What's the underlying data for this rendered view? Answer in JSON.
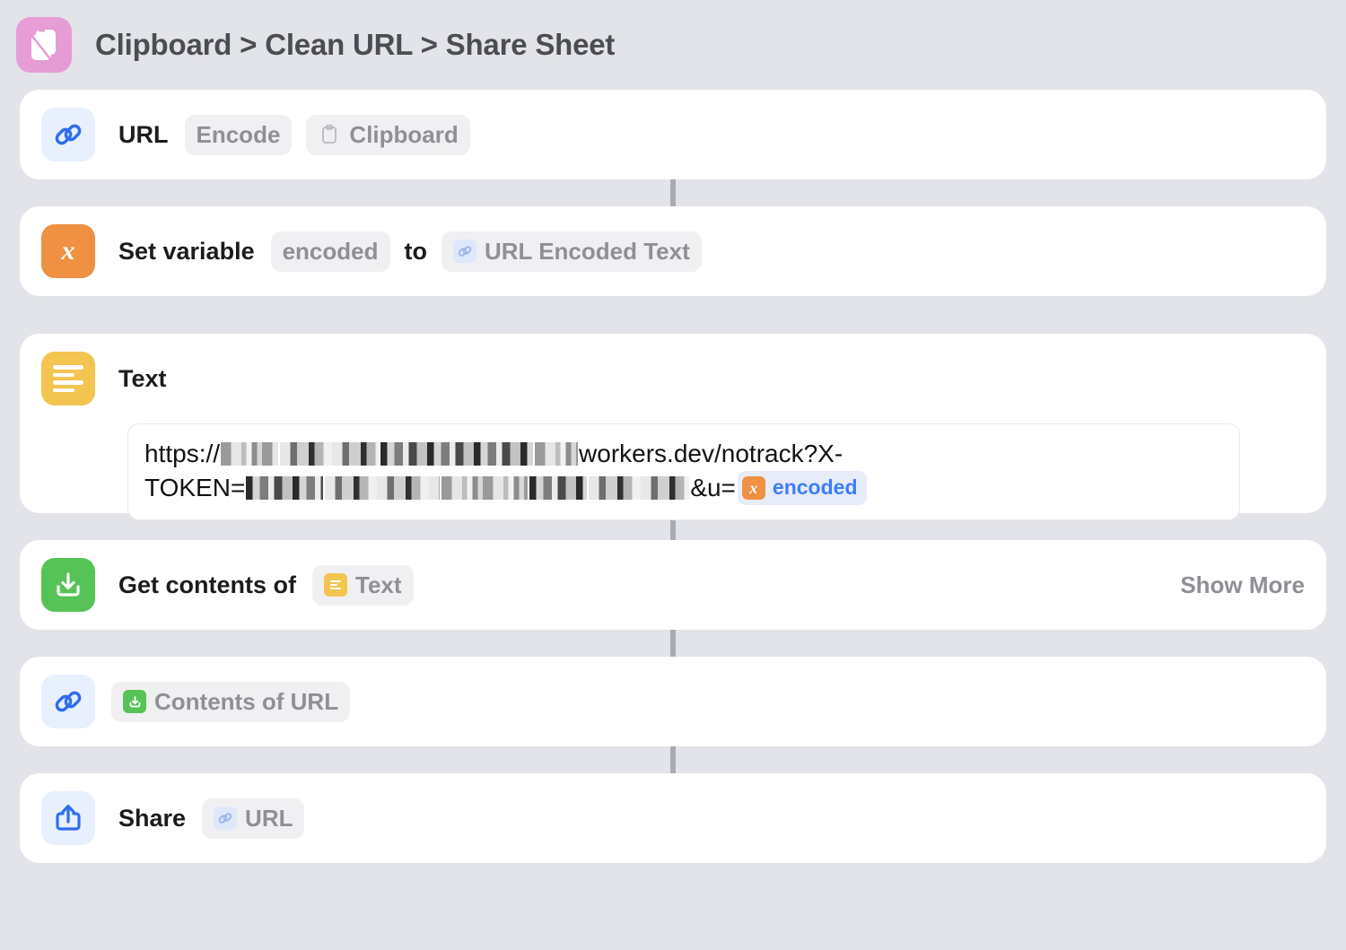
{
  "header": {
    "icon": "clipboard-app-icon",
    "title": "Clipboard > Clean URL > Share Sheet",
    "icon_color": "#e49ad3"
  },
  "theme": {
    "background": "#e3e4e9",
    "card_background": "#ffffff",
    "connector": "#a9abb2",
    "accent_blue": "#3d7dfb",
    "orange": "#ef9043",
    "yellow": "#f3c44f",
    "green": "#56c356",
    "pill_background": "#f0f0f2",
    "pill_text": "#8e9096",
    "label_text": "#1c1c1e"
  },
  "actions": [
    {
      "id": "url-encode",
      "icon": "link-icon",
      "label": "URL",
      "pills": [
        {
          "text": "Encode",
          "badge": "none"
        },
        {
          "text": "Clipboard",
          "badge": "clipboard-icon"
        }
      ]
    },
    {
      "id": "set-variable",
      "icon": "variable-x-icon",
      "label": "Set variable",
      "variable_name": "encoded",
      "connector_word": "to",
      "value_token": {
        "text": "URL Encoded Text",
        "badge": "link-icon"
      }
    },
    {
      "id": "text",
      "icon": "text-lines-icon",
      "label": "Text",
      "body": {
        "line1_prefix": "https://",
        "line1_suffix": "workers.dev/notrack?X-",
        "line2_prefix": "TOKEN=",
        "line2_suffix": "&u=",
        "variable_token": {
          "name": "encoded",
          "badge": "variable-x-icon"
        }
      }
    },
    {
      "id": "get-contents-of-url",
      "icon": "download-icon",
      "label": "Get contents of",
      "pills": [
        {
          "text": "Text",
          "badge": "text-lines-icon"
        }
      ],
      "trailing_action": "Show More"
    },
    {
      "id": "contents-of-url-output",
      "icon": "link-icon",
      "pills": [
        {
          "text": "Contents of URL",
          "badge": "download-icon"
        }
      ]
    },
    {
      "id": "share",
      "icon": "share-icon",
      "label": "Share",
      "pills": [
        {
          "text": "URL",
          "badge": "link-icon"
        }
      ]
    }
  ]
}
